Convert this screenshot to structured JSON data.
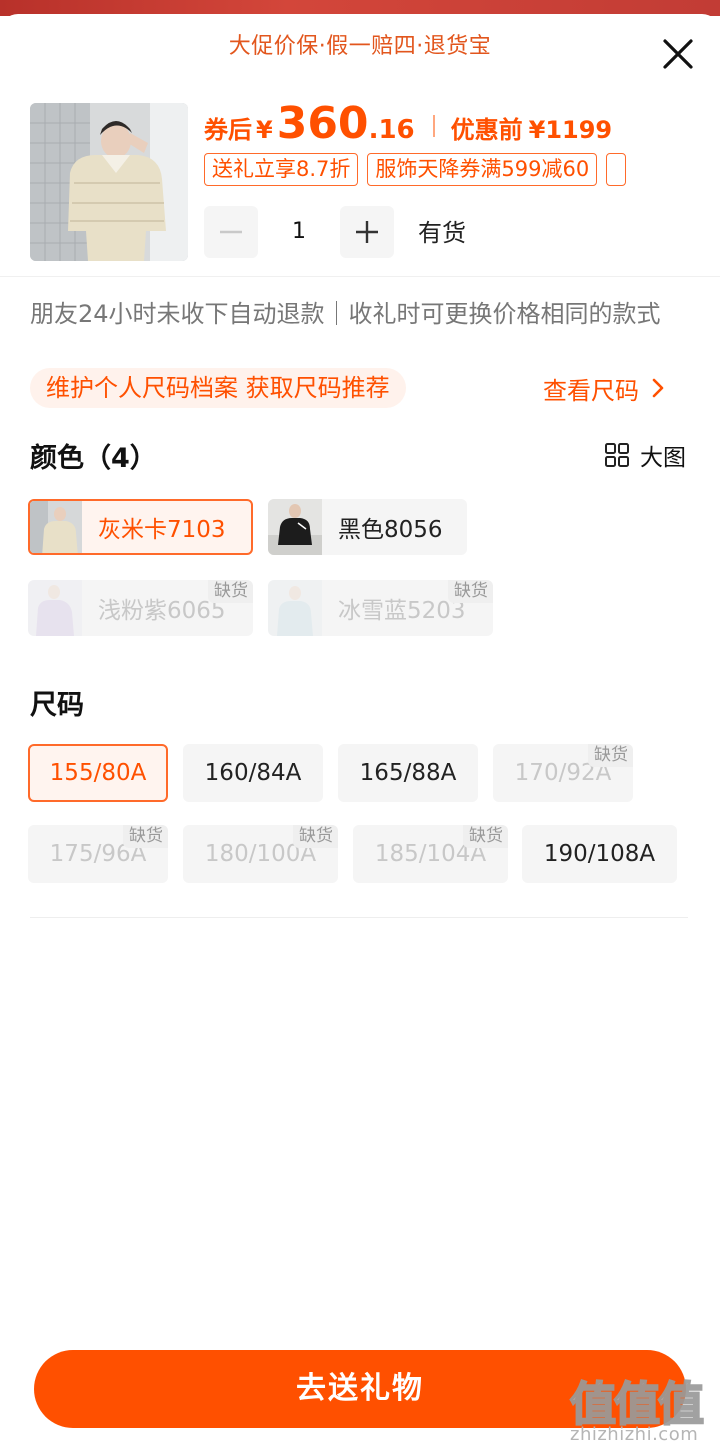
{
  "header": {
    "banner": "大促价保·假一赔四·退货宝"
  },
  "product": {
    "price_label": "券后",
    "currency": "¥",
    "price_int": "360",
    "price_dec": ".16",
    "orig_label": "优惠前",
    "orig_price": "¥1199",
    "tags": [
      "送礼立享8.7折",
      "服饰天降券满599减60",
      ""
    ],
    "quantity": "1",
    "stock_status": "有货"
  },
  "notice": "朋友24小时未收下自动退款｜收礼时可更换价格相同的款式",
  "size_profile": {
    "prompt": "维护个人尺码档案 获取尺码推荐",
    "link": "查看尺码"
  },
  "color_section": {
    "title": "颜色（4）",
    "bigview_label": "大图",
    "options": [
      {
        "label": "灰米卡7103",
        "state": "selected",
        "badge": ""
      },
      {
        "label": "黑色8056",
        "state": "available",
        "badge": ""
      },
      {
        "label": "浅粉紫6065",
        "state": "disabled",
        "badge": "缺货"
      },
      {
        "label": "冰雪蓝5203",
        "state": "disabled",
        "badge": "缺货"
      }
    ]
  },
  "size_section": {
    "title": "尺码",
    "options": [
      {
        "label": "155/80A",
        "state": "selected",
        "badge": ""
      },
      {
        "label": "160/84A",
        "state": "available",
        "badge": ""
      },
      {
        "label": "165/88A",
        "state": "available",
        "badge": ""
      },
      {
        "label": "170/92A",
        "state": "disabled",
        "badge": "缺货"
      },
      {
        "label": "175/96A",
        "state": "disabled",
        "badge": "缺货"
      },
      {
        "label": "180/100A",
        "state": "disabled",
        "badge": "缺货"
      },
      {
        "label": "185/104A",
        "state": "disabled",
        "badge": "缺货"
      },
      {
        "label": "190/108A",
        "state": "available",
        "badge": ""
      }
    ]
  },
  "cta": {
    "label": "去送礼物"
  },
  "watermark": {
    "big": "值值值",
    "small": "zhizhizhi.com"
  },
  "icons": {
    "close": "close-icon",
    "minus": "minus-icon",
    "plus": "plus-icon",
    "chevron": "chevron-right-icon",
    "grid": "grid-icon"
  },
  "colors": {
    "accent": "#ff5000",
    "accent_soft": "#fff2ec",
    "chip_bg": "#f5f5f5",
    "disabled_text": "#c8c8c8"
  }
}
